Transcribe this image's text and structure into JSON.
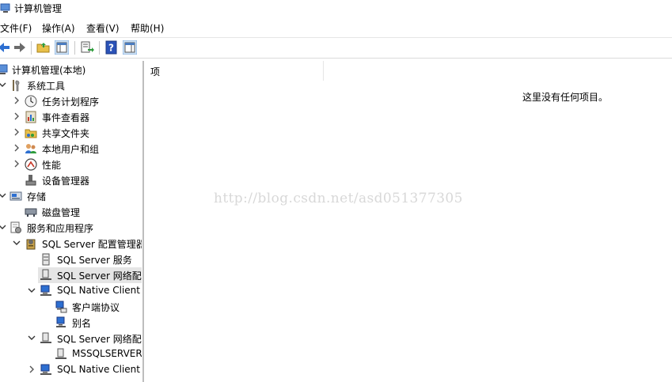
{
  "window": {
    "title": "计算机管理"
  },
  "menu": {
    "file": "文件(F)",
    "action": "操作(A)",
    "view": "查看(V)",
    "help": "帮助(H)"
  },
  "tree": {
    "root": "计算机管理(本地)",
    "system_tools": "系统工具",
    "task_scheduler": "任务计划程序",
    "event_viewer": "事件查看器",
    "shared_folders": "共享文件夹",
    "local_users": "本地用户和组",
    "performance": "性能",
    "device_manager": "设备管理器",
    "storage": "存储",
    "disk_management": "磁盘管理",
    "services_apps": "服务和应用程序",
    "sql_config_manager": "SQL Server 配置管理器",
    "sql_services": "SQL Server 服务",
    "sql_network_config_32": "SQL Server 网络配",
    "sql_native_client_32": "SQL Native Client",
    "client_protocols": "客户端协议",
    "aliases": "别名",
    "sql_network_config": "SQL Server 网络配",
    "mssqlserver": "MSSQLSERVER",
    "sql_native_client": "SQL Native Client"
  },
  "content": {
    "column_header": "项",
    "empty_message": "这里没有任何项目。"
  },
  "watermark": "http://blog.csdn.net/asd051377305"
}
